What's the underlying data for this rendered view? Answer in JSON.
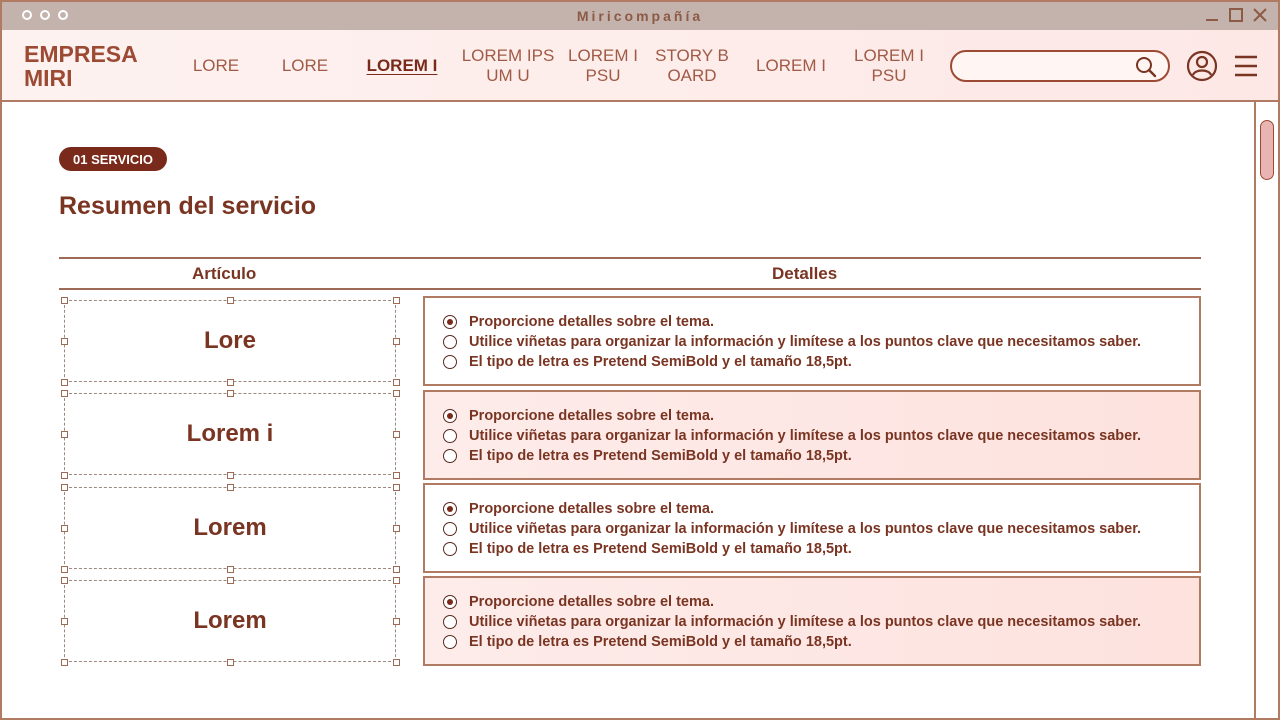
{
  "window": {
    "title": "Miricompañía"
  },
  "nav": {
    "brand_line1": "EMPRESA",
    "brand_line2": "MIRI",
    "items": [
      {
        "label": "LORE"
      },
      {
        "label": "LORE"
      },
      {
        "label": "LOREM I",
        "active": true
      },
      {
        "label": "LOREM IPS UM U"
      },
      {
        "label": "LOREM I PSU"
      },
      {
        "label": "STORY B OARD"
      },
      {
        "label": "LOREM I"
      },
      {
        "label": "LOREM I PSU"
      }
    ],
    "search_placeholder": ""
  },
  "section": {
    "badge": "01 SERVICIO",
    "title": "Resumen del servicio"
  },
  "table": {
    "col_article": "Artículo",
    "col_details": "Detalles",
    "rows": [
      {
        "article": "Lore",
        "style": "white",
        "details": [
          {
            "text": "Proporcione detalles sobre el tema.",
            "selected": true
          },
          {
            "text": "Utilice viñetas para organizar la información y limítese a los puntos clave que necesitamos saber.",
            "selected": false
          },
          {
            "text": "El tipo de letra es Pretend SemiBold y el tamaño 18,5pt.",
            "selected": false
          }
        ]
      },
      {
        "article": "Lorem i",
        "style": "pink",
        "details": [
          {
            "text": "Proporcione detalles sobre el tema.",
            "selected": true
          },
          {
            "text": "Utilice viñetas para organizar la información y limítese a los puntos clave que necesitamos saber.",
            "selected": false
          },
          {
            "text": "El tipo de letra es Pretend SemiBold y el tamaño 18,5pt.",
            "selected": false
          }
        ]
      },
      {
        "article": "Lorem",
        "style": "white",
        "details": [
          {
            "text": "Proporcione detalles sobre el tema.",
            "selected": true
          },
          {
            "text": "Utilice viñetas para organizar la información y limítese a los puntos clave que necesitamos saber.",
            "selected": false
          },
          {
            "text": "El tipo de letra es Pretend SemiBold y el tamaño 18,5pt.",
            "selected": false
          }
        ]
      },
      {
        "article": "Lorem",
        "style": "pink",
        "details": [
          {
            "text": "Proporcione detalles sobre el tema.",
            "selected": true
          },
          {
            "text": "Utilice viñetas para organizar la información y limítese a los puntos clave que necesitamos saber.",
            "selected": false
          },
          {
            "text": "El tipo de letra es Pretend SemiBold y el tamaño 18,5pt.",
            "selected": false
          }
        ]
      }
    ]
  },
  "colors": {
    "accent": "#7a2a1a",
    "border": "#b07a63",
    "titlebar": "#c4b3ad"
  }
}
